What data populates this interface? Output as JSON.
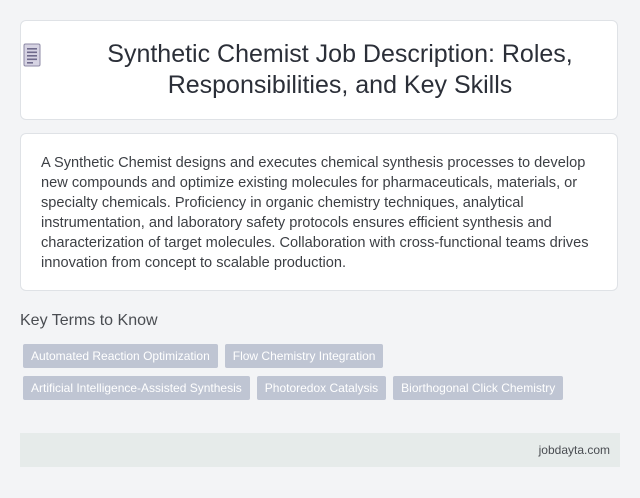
{
  "header": {
    "icon": "document-icon",
    "title": "Synthetic Chemist Job Description: Roles, Responsibilities, and Key Skills"
  },
  "description": "A Synthetic Chemist designs and executes chemical synthesis processes to develop new compounds and optimize existing molecules for pharmaceuticals, materials, or specialty chemicals. Proficiency in organic chemistry techniques, analytical instrumentation, and laboratory safety protocols ensures efficient synthesis and characterization of target molecules. Collaboration with cross-functional teams drives innovation from concept to scalable production.",
  "key_terms": {
    "heading": "Key Terms to Know",
    "items": [
      "Automated Reaction Optimization",
      "Flow Chemistry Integration",
      "Artificial Intelligence-Assisted Synthesis",
      "Photoredox Catalysis",
      "Biorthogonal Click Chemistry"
    ]
  },
  "footer": {
    "site": "jobdayta.com"
  },
  "colors": {
    "background": "#f3f4f6",
    "tag": "#bfc5d3",
    "footer": "#e6ebea"
  }
}
